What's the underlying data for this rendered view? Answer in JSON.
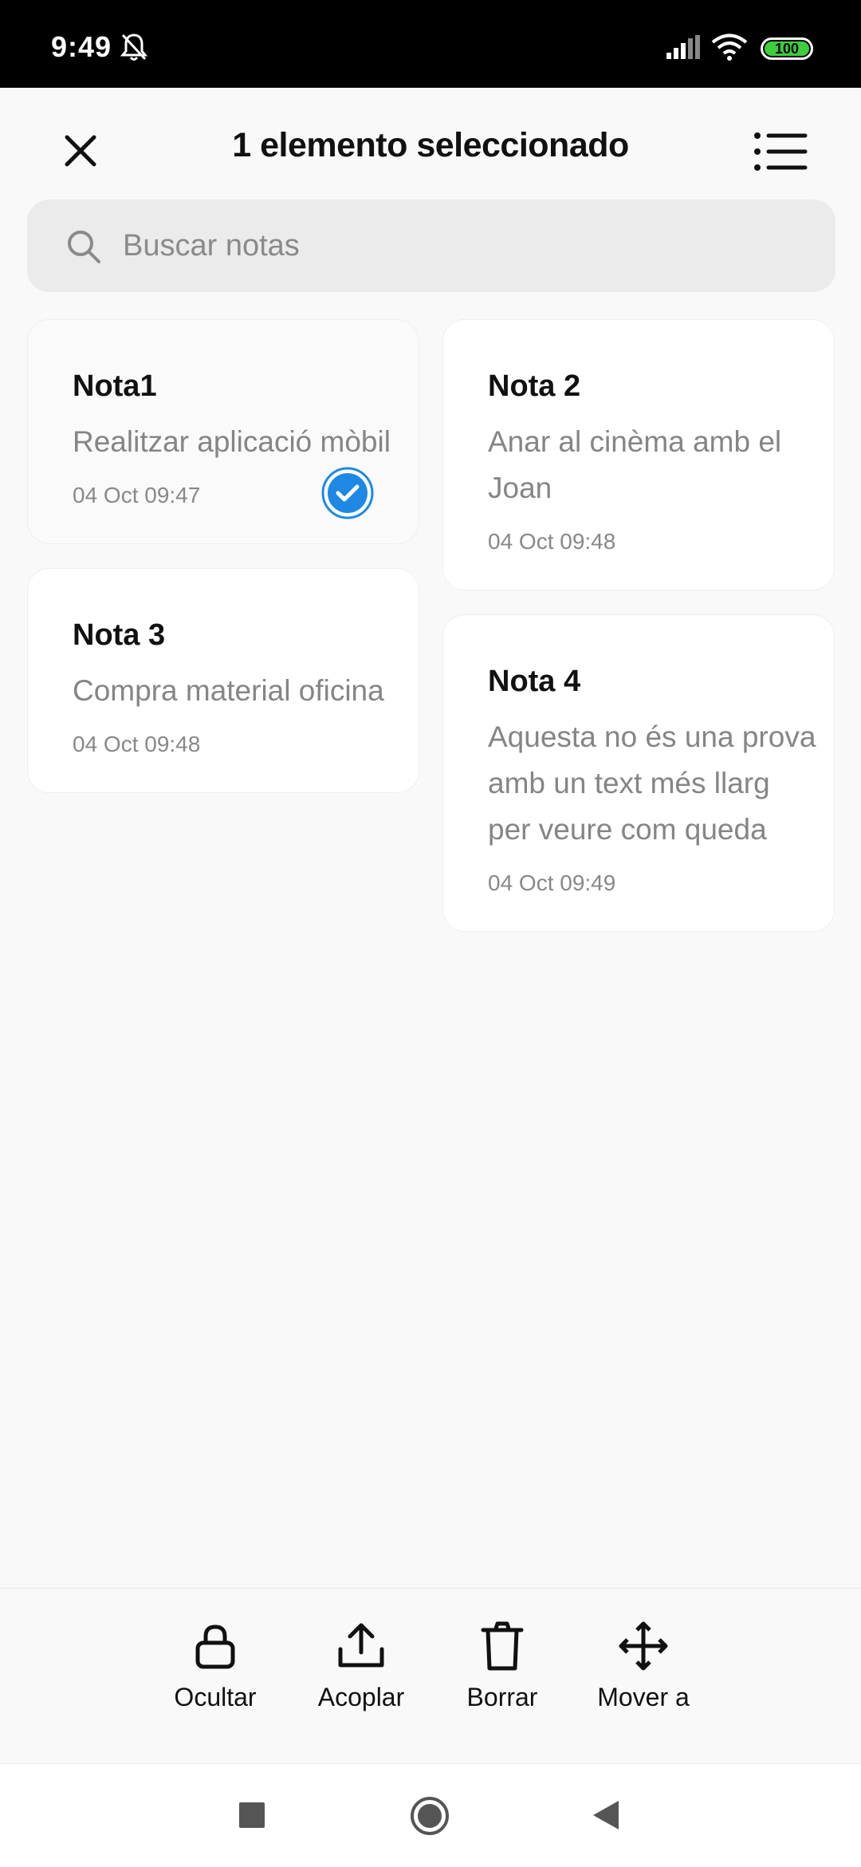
{
  "status_bar": {
    "time": "9:49",
    "battery": "100",
    "icons": [
      "bell-off-icon",
      "signal-icon",
      "wifi-icon",
      "battery-icon"
    ]
  },
  "header": {
    "title": "1 elemento seleccionado",
    "close_icon": "close-icon",
    "view_icon": "list-view-icon"
  },
  "search": {
    "placeholder": "Buscar notas",
    "value": ""
  },
  "notes": [
    {
      "title": "Nota1",
      "body": "Realitzar aplicació mòbil",
      "date": "04 Oct 09:47",
      "selected": true
    },
    {
      "title": "Nota 2",
      "body_lines": [
        "Anar al cinèma amb el",
        "Joan"
      ],
      "date": "04 Oct 09:48",
      "selected": false
    },
    {
      "title": "Nota 3",
      "body": "Compra material oficina",
      "date": "04 Oct 09:48",
      "selected": false
    },
    {
      "title": "Nota 4",
      "body_lines": [
        "Aquesta no és una prova",
        "amb un text més llarg",
        "per veure com queda"
      ],
      "date": "04 Oct 09:49",
      "selected": false
    }
  ],
  "actions": [
    {
      "label": "Ocultar",
      "icon": "lock-icon"
    },
    {
      "label": "Acoplar",
      "icon": "upload-icon"
    },
    {
      "label": "Borrar",
      "icon": "trash-icon"
    },
    {
      "label": "Mover a",
      "icon": "move-icon"
    }
  ],
  "colors": {
    "accent": "#1e88e5",
    "battery": "#3dcd3d",
    "background": "#f9f9f9"
  }
}
